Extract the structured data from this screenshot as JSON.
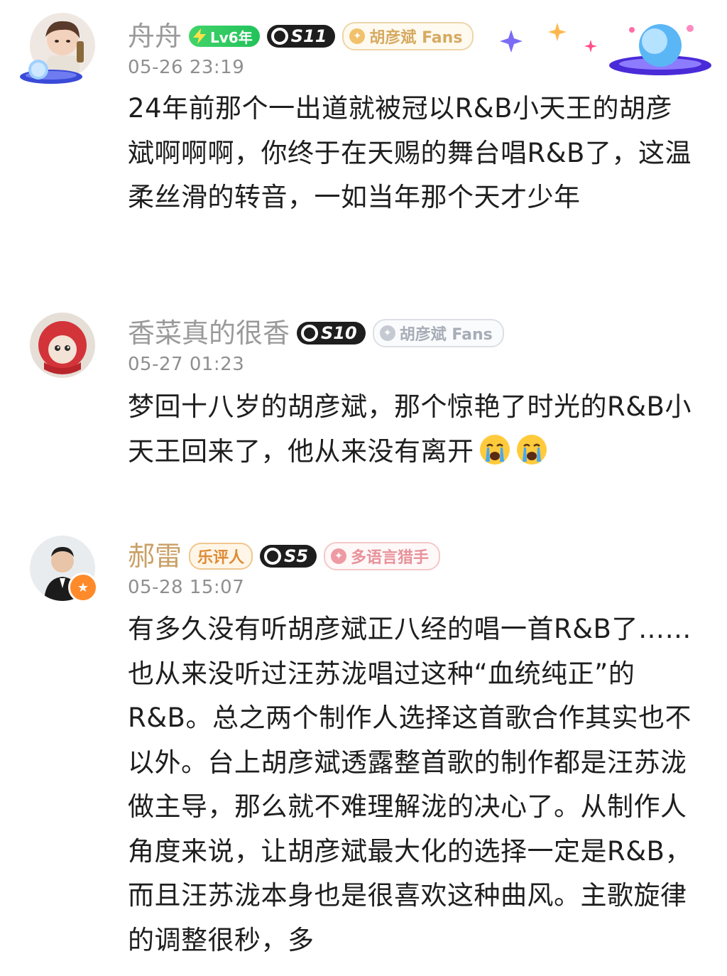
{
  "comments": [
    {
      "username": "舟舟",
      "level_badge": "Lv6年",
      "s_badge": "S11",
      "fans_badge": "胡彦斌 Fans",
      "timestamp": "05-26 23:19",
      "text": "24年前那个一出道就被冠以R&B小天王的胡彦斌啊啊啊，你终于在天赐的舞台唱R&B了，这温柔丝滑的转音，一如当年那个天才少年"
    },
    {
      "username": "香菜真的很香",
      "s_badge": "S10",
      "fans_badge": "胡彦斌 Fans",
      "timestamp": "05-27 01:23",
      "text": "梦回十八岁的胡彦斌，那个惊艳了时光的R&B小天王回来了，他从来没有离开"
    },
    {
      "username": "郝雷",
      "critic_badge": "乐评人",
      "s_badge": "S5",
      "fans_badge": "多语言猎手",
      "timestamp": "05-28 15:07",
      "text": "有多久没有听胡彦斌正八经的唱一首R&B了……也从来没听过汪苏泷唱过这种“血统纯正”的R&B。总之两个制作人选择这首歌合作其实也不以外。台上胡彦斌透露整首歌的制作都是汪苏泷做主导，那么就不难理解泷的决心了。从制作人角度来说，让胡彦斌最大化的选择一定是R&B，而且汪苏泷本身也是很喜欢这种曲风。主歌旋律的调整很秒，多"
    }
  ],
  "colors": {
    "username_gray": "#9a9a9a",
    "username_gold": "#c9a066",
    "timestamp": "#8f8f8f",
    "text": "#1e1e1e"
  },
  "icons": [
    "avatar",
    "lightning-icon",
    "s-ring-icon",
    "fan-hexagon-icon",
    "crying-emoji",
    "vip-star-icon",
    "sparkle-decor"
  ]
}
